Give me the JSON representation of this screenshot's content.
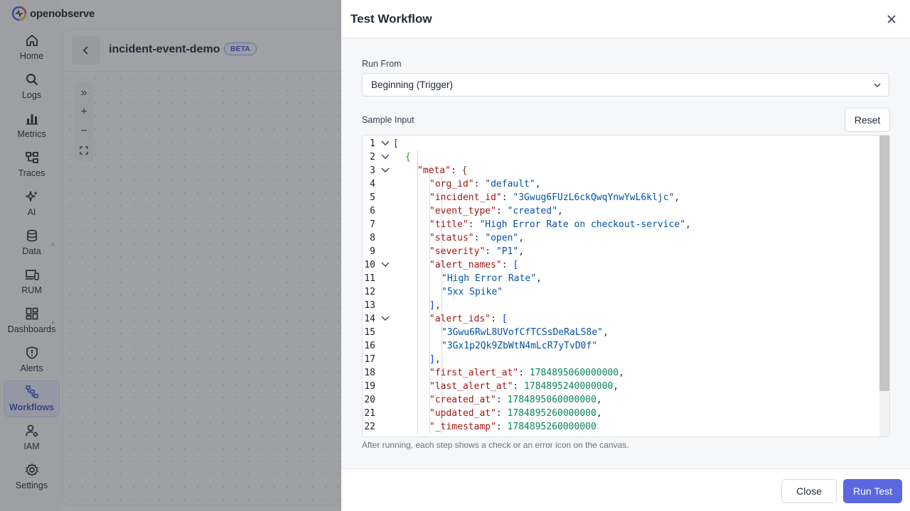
{
  "brand": {
    "name": "openobserve"
  },
  "sidebar": {
    "items": [
      {
        "label": "Home",
        "icon": "home-icon"
      },
      {
        "label": "Logs",
        "icon": "search-icon"
      },
      {
        "label": "Metrics",
        "icon": "bar-chart-icon"
      },
      {
        "label": "Traces",
        "icon": "traces-icon"
      },
      {
        "label": "AI",
        "icon": "sparkle-icon"
      },
      {
        "label": "Data",
        "icon": "database-icon",
        "has_submenu": true
      },
      {
        "label": "RUM",
        "icon": "devices-icon"
      },
      {
        "label": "Dashboards",
        "icon": "dashboard-icon",
        "has_submenu": true
      },
      {
        "label": "Alerts",
        "icon": "shield-alert-icon"
      },
      {
        "label": "Workflows",
        "icon": "workflow-icon",
        "active": true
      },
      {
        "label": "IAM",
        "icon": "user-gear-icon"
      },
      {
        "label": "Settings",
        "icon": "gear-icon"
      }
    ]
  },
  "workflow": {
    "name": "incident-event-demo",
    "badge": "BETA"
  },
  "canvas_tools": {
    "expand": "»",
    "zoom_in": "+",
    "zoom_out": "−"
  },
  "drawer": {
    "title": "Test Workflow",
    "run_from": {
      "label": "Run From",
      "value": "Beginning (Trigger)"
    },
    "sample_input": {
      "label": "Sample Input",
      "reset_label": "Reset"
    },
    "hint": "After running, each step shows a check or an error icon on the canvas.",
    "close_label": "Close",
    "run_label": "Run Test"
  },
  "editor": {
    "lines": [
      {
        "n": "1",
        "depth": 0,
        "fold": true,
        "tokens": [
          [
            "b1",
            "["
          ]
        ]
      },
      {
        "n": "2",
        "depth": 1,
        "fold": true,
        "tokens": [
          [
            "b2",
            "{"
          ]
        ]
      },
      {
        "n": "3",
        "depth": 2,
        "fold": true,
        "tokens": [
          [
            "k",
            "\"meta\""
          ],
          [
            "p",
            ": "
          ],
          [
            "b3",
            "{"
          ]
        ]
      },
      {
        "n": "4",
        "depth": 3,
        "fold": false,
        "tokens": [
          [
            "k",
            "\"org_id\""
          ],
          [
            "p",
            ": "
          ],
          [
            "s",
            "\"default\""
          ],
          [
            "p",
            ","
          ]
        ]
      },
      {
        "n": "5",
        "depth": 3,
        "fold": false,
        "tokens": [
          [
            "k",
            "\"incident_id\""
          ],
          [
            "p",
            ": "
          ],
          [
            "s",
            "\"3Gwug6FUzL6ckQwqYnwYwL6kljc\""
          ],
          [
            "p",
            ","
          ]
        ]
      },
      {
        "n": "6",
        "depth": 3,
        "fold": false,
        "tokens": [
          [
            "k",
            "\"event_type\""
          ],
          [
            "p",
            ": "
          ],
          [
            "s",
            "\"created\""
          ],
          [
            "p",
            ","
          ]
        ]
      },
      {
        "n": "7",
        "depth": 3,
        "fold": false,
        "tokens": [
          [
            "k",
            "\"title\""
          ],
          [
            "p",
            ": "
          ],
          [
            "s",
            "\"High Error Rate on checkout-service\""
          ],
          [
            "p",
            ","
          ]
        ]
      },
      {
        "n": "8",
        "depth": 3,
        "fold": false,
        "tokens": [
          [
            "k",
            "\"status\""
          ],
          [
            "p",
            ": "
          ],
          [
            "s",
            "\"open\""
          ],
          [
            "p",
            ","
          ]
        ]
      },
      {
        "n": "9",
        "depth": 3,
        "fold": false,
        "tokens": [
          [
            "k",
            "\"severity\""
          ],
          [
            "p",
            ": "
          ],
          [
            "s",
            "\"P1\""
          ],
          [
            "p",
            ","
          ]
        ]
      },
      {
        "n": "10",
        "depth": 3,
        "fold": true,
        "tokens": [
          [
            "k",
            "\"alert_names\""
          ],
          [
            "p",
            ": "
          ],
          [
            "b1",
            "["
          ]
        ]
      },
      {
        "n": "11",
        "depth": 4,
        "fold": false,
        "tokens": [
          [
            "s",
            "\"High Error Rate\""
          ],
          [
            "p",
            ","
          ]
        ]
      },
      {
        "n": "12",
        "depth": 4,
        "fold": false,
        "tokens": [
          [
            "s",
            "\"5xx Spike\""
          ]
        ]
      },
      {
        "n": "13",
        "depth": 3,
        "fold": false,
        "tokens": [
          [
            "b1",
            "]"
          ],
          [
            "p",
            ","
          ]
        ]
      },
      {
        "n": "14",
        "depth": 3,
        "fold": true,
        "tokens": [
          [
            "k",
            "\"alert_ids\""
          ],
          [
            "p",
            ": "
          ],
          [
            "b1",
            "["
          ]
        ]
      },
      {
        "n": "15",
        "depth": 4,
        "fold": false,
        "tokens": [
          [
            "s",
            "\"3Gwu6RwL8UVofCfTCSsDeRaLS8e\""
          ],
          [
            "p",
            ","
          ]
        ]
      },
      {
        "n": "16",
        "depth": 4,
        "fold": false,
        "tokens": [
          [
            "s",
            "\"3Gx1p2Qk9ZbWtN4mLcR7yTvD0f\""
          ]
        ]
      },
      {
        "n": "17",
        "depth": 3,
        "fold": false,
        "tokens": [
          [
            "b1",
            "]"
          ],
          [
            "p",
            ","
          ]
        ]
      },
      {
        "n": "18",
        "depth": 3,
        "fold": false,
        "tokens": [
          [
            "k",
            "\"first_alert_at\""
          ],
          [
            "p",
            ": "
          ],
          [
            "n",
            "1784895060000000"
          ],
          [
            "p",
            ","
          ]
        ]
      },
      {
        "n": "19",
        "depth": 3,
        "fold": false,
        "tokens": [
          [
            "k",
            "\"last_alert_at\""
          ],
          [
            "p",
            ": "
          ],
          [
            "n",
            "1784895240000000"
          ],
          [
            "p",
            ","
          ]
        ]
      },
      {
        "n": "20",
        "depth": 3,
        "fold": false,
        "tokens": [
          [
            "k",
            "\"created_at\""
          ],
          [
            "p",
            ": "
          ],
          [
            "n",
            "1784895060000000"
          ],
          [
            "p",
            ","
          ]
        ]
      },
      {
        "n": "21",
        "depth": 3,
        "fold": false,
        "tokens": [
          [
            "k",
            "\"updated_at\""
          ],
          [
            "p",
            ": "
          ],
          [
            "n",
            "1784895260000000"
          ],
          [
            "p",
            ","
          ]
        ]
      },
      {
        "n": "22",
        "depth": 3,
        "fold": false,
        "tokens": [
          [
            "k",
            "\"_timestamp\""
          ],
          [
            "p",
            ": "
          ],
          [
            "n",
            "1784895260000000"
          ]
        ]
      }
    ]
  }
}
